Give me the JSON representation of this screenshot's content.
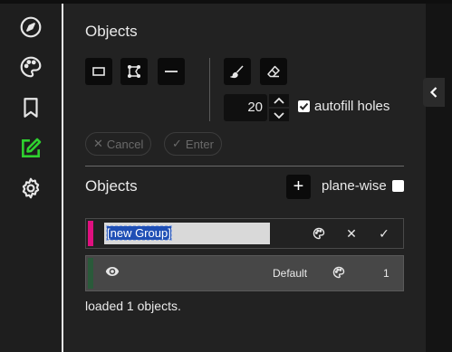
{
  "sidebar": {
    "items": [
      {
        "icon": "compass-icon",
        "active": false
      },
      {
        "icon": "palette-icon",
        "active": false
      },
      {
        "icon": "bookmark-icon",
        "active": false
      },
      {
        "icon": "edit-icon",
        "active": true
      },
      {
        "icon": "gear-icon",
        "active": false
      }
    ],
    "active_color": "#2fd12f"
  },
  "tools_section": {
    "title": "Objects",
    "tools": [
      "rectangle-icon",
      "polygon-icon",
      "line-icon",
      "brush-icon",
      "eraser-icon"
    ],
    "brush_size": "20",
    "autofill_label": "autofill holes",
    "autofill_checked": true,
    "cancel_label": "Cancel",
    "enter_label": "Enter"
  },
  "objects_section": {
    "title": "Objects",
    "plus_label": "+",
    "plane_wise_label": "plane-wise",
    "plane_wise_checked": false,
    "new_group": {
      "name_value": "[new Group]",
      "color": "#e0107f"
    },
    "groups": [
      {
        "name": "Default",
        "count": "1",
        "color": "#2a5a3a"
      }
    ],
    "status": "loaded 1 objects."
  },
  "colors": {
    "accent_green": "#2fd12f",
    "panel_bg": "#222222",
    "button_bg": "#0b0b0b"
  }
}
